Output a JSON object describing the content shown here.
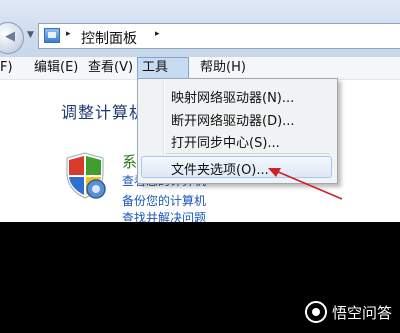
{
  "address_bar": {
    "back_icon": "back-arrow-icon",
    "history_icon": "chevron-down-icon",
    "location_icon": "control-panel-icon",
    "separator_glyph": "▸",
    "path": "控制面板"
  },
  "menubar": {
    "items": [
      {
        "label": "F)"
      },
      {
        "label": "编辑(E)"
      },
      {
        "label": "查看(V)"
      },
      {
        "label": "工具(T)"
      },
      {
        "label": "帮助(H)"
      }
    ],
    "active": "工具(T)"
  },
  "content": {
    "title": "调整计算机",
    "section": {
      "heading": "系",
      "icon": "security-shield-icon",
      "links": [
        "查看您的计算机",
        "备份您的计算机",
        "查找并解决问题"
      ]
    }
  },
  "tools_menu": {
    "items": [
      {
        "label": "映射网络驱动器(N)..."
      },
      {
        "label": "断开网络驱动器(D)..."
      },
      {
        "label": "打开同步中心(S)..."
      },
      {
        "label": "文件夹选项(O)..."
      }
    ],
    "highlighted": "文件夹选项(O)..."
  },
  "annotation": {
    "icon": "red-arrow-icon",
    "color": "#d0202a"
  },
  "watermark": {
    "text": "悟空问答"
  }
}
